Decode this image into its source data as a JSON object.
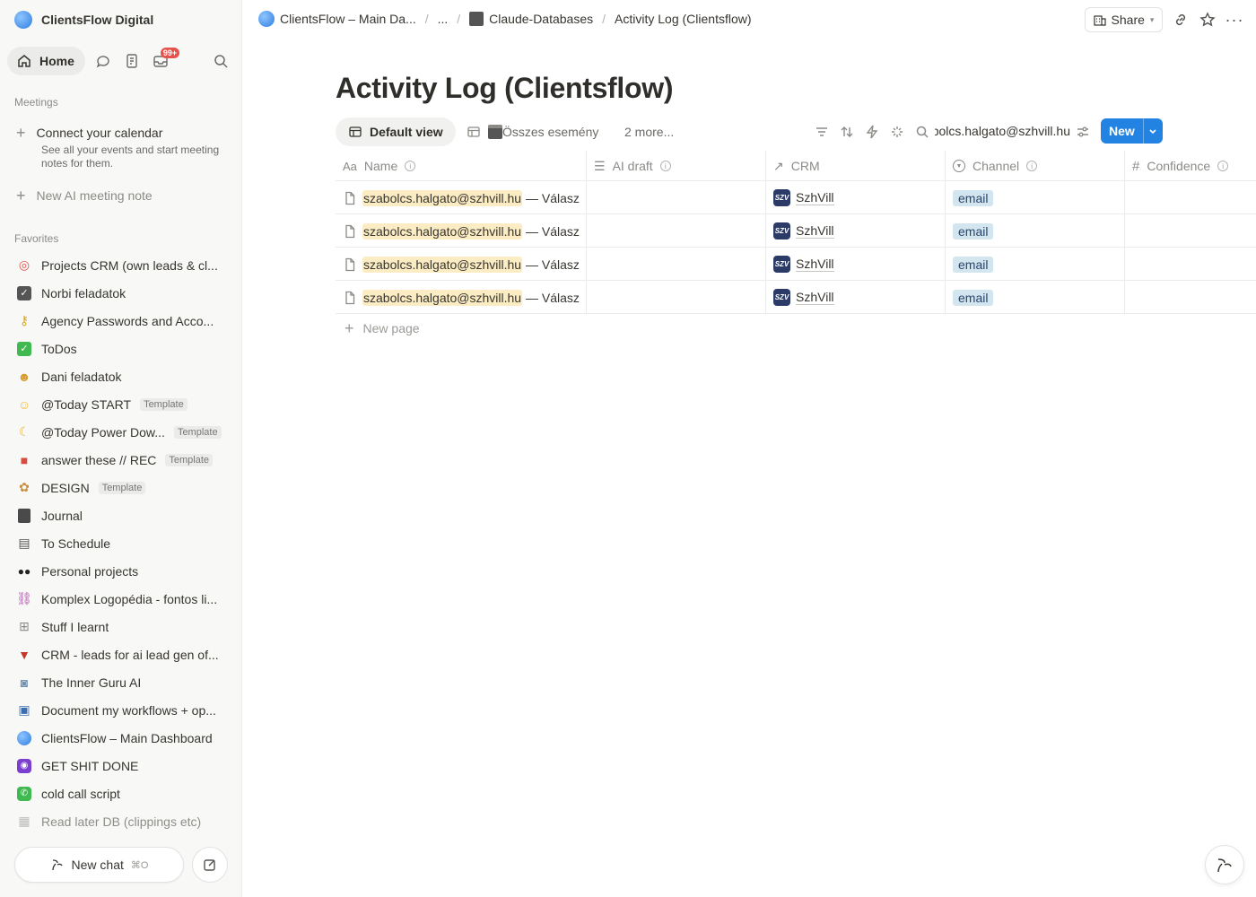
{
  "workspace": {
    "name": "ClientsFlow Digital"
  },
  "nav": {
    "home_label": "Home",
    "inbox_badge": "99+"
  },
  "meetings": {
    "section_label": "Meetings",
    "connect_title": "Connect your calendar",
    "connect_sub": "See all your events and start meeting notes for them.",
    "new_ai_note": "New AI meeting note"
  },
  "favorites": {
    "section_label": "Favorites",
    "items": [
      {
        "label": "Projects CRM (own leads & cl...",
        "icon": "target-icon",
        "tag": ""
      },
      {
        "label": "Norbi feladatok",
        "icon": "checkbox-icon",
        "tag": ""
      },
      {
        "label": "Agency Passwords and Acco...",
        "icon": "key-icon",
        "tag": ""
      },
      {
        "label": "ToDos",
        "icon": "check-mark-icon",
        "tag": ""
      },
      {
        "label": "Dani feladatok",
        "icon": "cat-icon",
        "tag": ""
      },
      {
        "label": "@Today START",
        "icon": "smile-icon",
        "tag": "Template"
      },
      {
        "label": "@Today Power Dow...",
        "icon": "moon-icon",
        "tag": "Template"
      },
      {
        "label": "answer these // REC",
        "icon": "video-icon",
        "tag": "Template"
      },
      {
        "label": "DESIGN",
        "icon": "palette-icon",
        "tag": "Template"
      },
      {
        "label": "Journal",
        "icon": "notebook-icon",
        "tag": ""
      },
      {
        "label": "To Schedule",
        "icon": "ledger-icon",
        "tag": ""
      },
      {
        "label": "Personal projects",
        "icon": "sunglasses-icon",
        "tag": ""
      },
      {
        "label": "Komplex Logopédia - fontos li...",
        "icon": "link-icon",
        "tag": ""
      },
      {
        "label": "Stuff I learnt",
        "icon": "table-icon",
        "tag": ""
      },
      {
        "label": "CRM - leads for ai lead gen of...",
        "icon": "inbox-tray-icon",
        "tag": ""
      },
      {
        "label": "The Inner Guru AI",
        "icon": "robot-icon",
        "tag": ""
      },
      {
        "label": "Document my workflows + op...",
        "icon": "chip-icon",
        "tag": ""
      },
      {
        "label": "ClientsFlow – Main Dashboard",
        "icon": "clientsflow-logo-icon",
        "tag": ""
      },
      {
        "label": "GET SHIT DONE",
        "icon": "eye-icon",
        "tag": ""
      },
      {
        "label": "cold call script",
        "icon": "phone-icon",
        "tag": ""
      },
      {
        "label": "Read later DB (clippings etc)",
        "icon": "newspaper-icon",
        "tag": ""
      }
    ]
  },
  "bottom": {
    "new_chat": "New chat",
    "new_chat_kbd": "⌘O"
  },
  "breadcrumb": {
    "items": [
      "ClientsFlow – Main Da...",
      "...",
      "Claude-Databases",
      "Activity Log (Clientsflow)"
    ]
  },
  "topbar": {
    "share_label": "Share"
  },
  "page": {
    "title": "Activity Log (Clientsflow)"
  },
  "views": {
    "default_view": "Default view",
    "second_view": "Összes esemény",
    "more": "2 more...",
    "search_value": "szabolcs.halgato@szhvill.hu",
    "new_label": "New"
  },
  "table": {
    "columns": [
      {
        "label": "Name",
        "icon": "text-type-icon"
      },
      {
        "label": "AI draft",
        "icon": "lines-icon"
      },
      {
        "label": "CRM",
        "icon": "relation-arrow-icon"
      },
      {
        "label": "Channel",
        "icon": "select-icon"
      },
      {
        "label": "Confidence",
        "icon": "number-icon"
      }
    ],
    "rows": [
      {
        "email": "szabolcs.halgato@szhvill.hu",
        "rest": " — Válasz",
        "ai_draft": "",
        "crm": "SzhVill",
        "crm_logo": "SZV",
        "channel": "email",
        "confidence": ""
      },
      {
        "email": "szabolcs.halgato@szhvill.hu",
        "rest": " — Válasz",
        "ai_draft": "",
        "crm": "SzhVill",
        "crm_logo": "SZV",
        "channel": "email",
        "confidence": ""
      },
      {
        "email": "szabolcs.halgato@szhvill.hu",
        "rest": " — Válasz",
        "ai_draft": "",
        "crm": "SzhVill",
        "crm_logo": "SZV",
        "channel": "email",
        "confidence": ""
      },
      {
        "email": "szabolcs.halgato@szhvill.hu",
        "rest": " — Válasz",
        "ai_draft": "",
        "crm": "SzhVill",
        "crm_logo": "SZV",
        "channel": "email",
        "confidence": ""
      }
    ],
    "new_page": "New page"
  },
  "colors": {
    "accent": "#2383e2",
    "highlight": "#fbecc4",
    "chip_bg": "#d3e5ef",
    "badge": "#e5534b"
  }
}
